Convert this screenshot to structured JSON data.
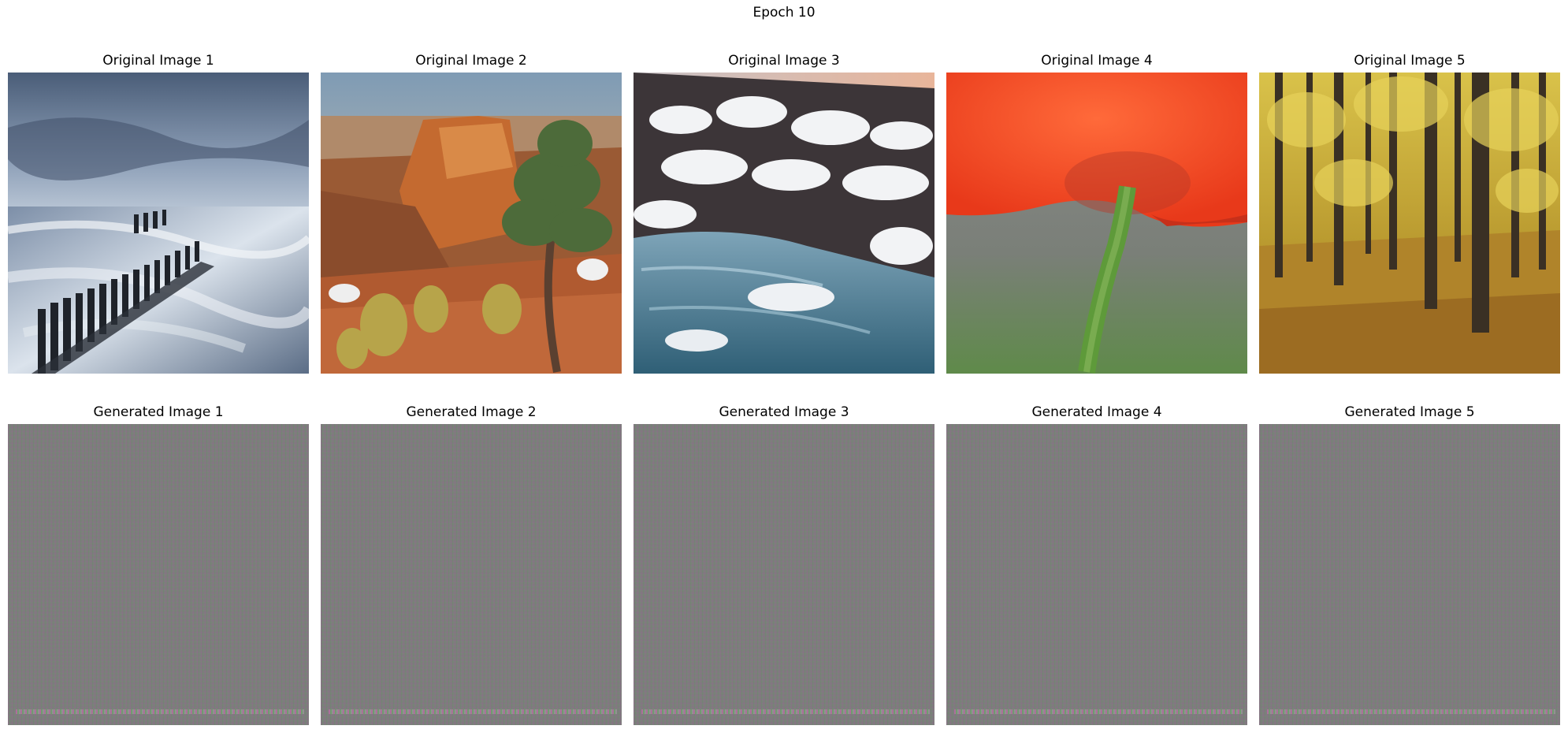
{
  "figure": {
    "title": "Epoch 10",
    "original_labels": [
      "Original Image 1",
      "Original Image 2",
      "Original Image 3",
      "Original Image 4",
      "Original Image 5"
    ],
    "generated_labels": [
      "Generated Image 1",
      "Generated Image 2",
      "Generated Image 3",
      "Generated Image 4",
      "Generated Image 5"
    ]
  }
}
